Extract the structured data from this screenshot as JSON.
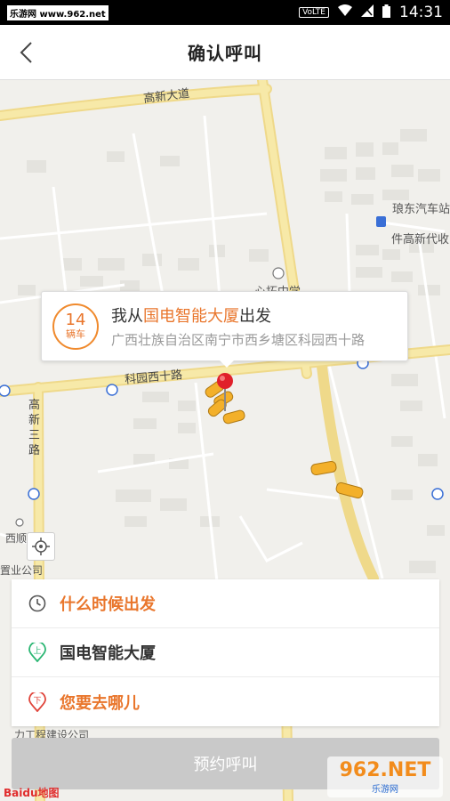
{
  "status_bar": {
    "watermark": "乐游网 www.962.net",
    "volte": "VoLTE",
    "time": "14:31"
  },
  "nav": {
    "title": "确认呼叫"
  },
  "map": {
    "roads": {
      "gaoxin_avenue": "高新大道",
      "keyuan_west10": "科园西十路",
      "gaoxin_san": [
        "高",
        "新",
        "三",
        "路"
      ]
    },
    "pois": {
      "bus_station": "琅东汽车站",
      "gaoxin_agent": "件高新代收",
      "middle_school": "心拓中学",
      "industry_company": "置业公司",
      "guangxi_partial": "西顺",
      "engineering_company": "力工程建设公司"
    }
  },
  "callout": {
    "car_count": "14",
    "car_unit": "辆车",
    "prefix": "我从",
    "place": "国电智能大厦",
    "suffix": "出发",
    "address": "广西壮族自治区南宁市西乡塘区科园西十路"
  },
  "panel": {
    "when_label": "什么时候出发",
    "from_label": "国电智能大厦",
    "to_label": "您要去哪儿"
  },
  "submit_label": "预约呼叫",
  "baidu_logo": "Baidu地图",
  "site_watermark": {
    "big": "962.NET",
    "small": "乐游网"
  },
  "colors": {
    "accent": "#e9762c",
    "road": "#f6e08a",
    "start_green": "#2bb673",
    "end_red": "#e0443a"
  }
}
